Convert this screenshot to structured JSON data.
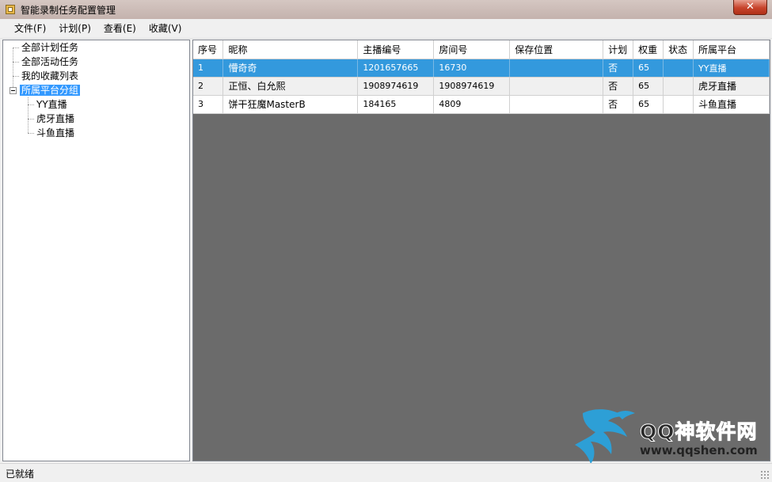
{
  "window": {
    "title": "智能录制任务配置管理",
    "close_label": "✕"
  },
  "menu": [
    {
      "label": "文件(F)"
    },
    {
      "label": "计划(P)"
    },
    {
      "label": "查看(E)"
    },
    {
      "label": "收藏(V)"
    }
  ],
  "tree": {
    "nodes": [
      {
        "label": "全部计划任务"
      },
      {
        "label": "全部活动任务"
      },
      {
        "label": "我的收藏列表"
      },
      {
        "label": "所属平台分组",
        "selected": true,
        "expanded": true
      },
      {
        "label": "YY直播"
      },
      {
        "label": "虎牙直播"
      },
      {
        "label": "斗鱼直播"
      }
    ]
  },
  "grid": {
    "columns": [
      "序号",
      "昵称",
      "主播编号",
      "房间号",
      "保存位置",
      "计划",
      "权重",
      "状态",
      "所属平台"
    ],
    "rows": [
      [
        "1",
        "懵奇奇",
        "1201657665",
        "16730",
        "",
        "否",
        "65",
        "",
        "YY直播"
      ],
      [
        "2",
        "正恒、白允熙",
        "1908974619",
        "1908974619",
        "",
        "否",
        "65",
        "",
        "虎牙直播"
      ],
      [
        "3",
        "饼干狂魔MasterB",
        "184165",
        "4809",
        "",
        "否",
        "65",
        "",
        "斗鱼直播"
      ]
    ],
    "selected_row": 0
  },
  "watermark": {
    "line1": "QQ神软件网",
    "line2": "www.qqshen.com"
  },
  "status": {
    "text": "已就绪"
  },
  "colors": {
    "selection": "#3399dd",
    "grid_background": "#6b6b6b",
    "tree_selection": "#3399ff"
  }
}
